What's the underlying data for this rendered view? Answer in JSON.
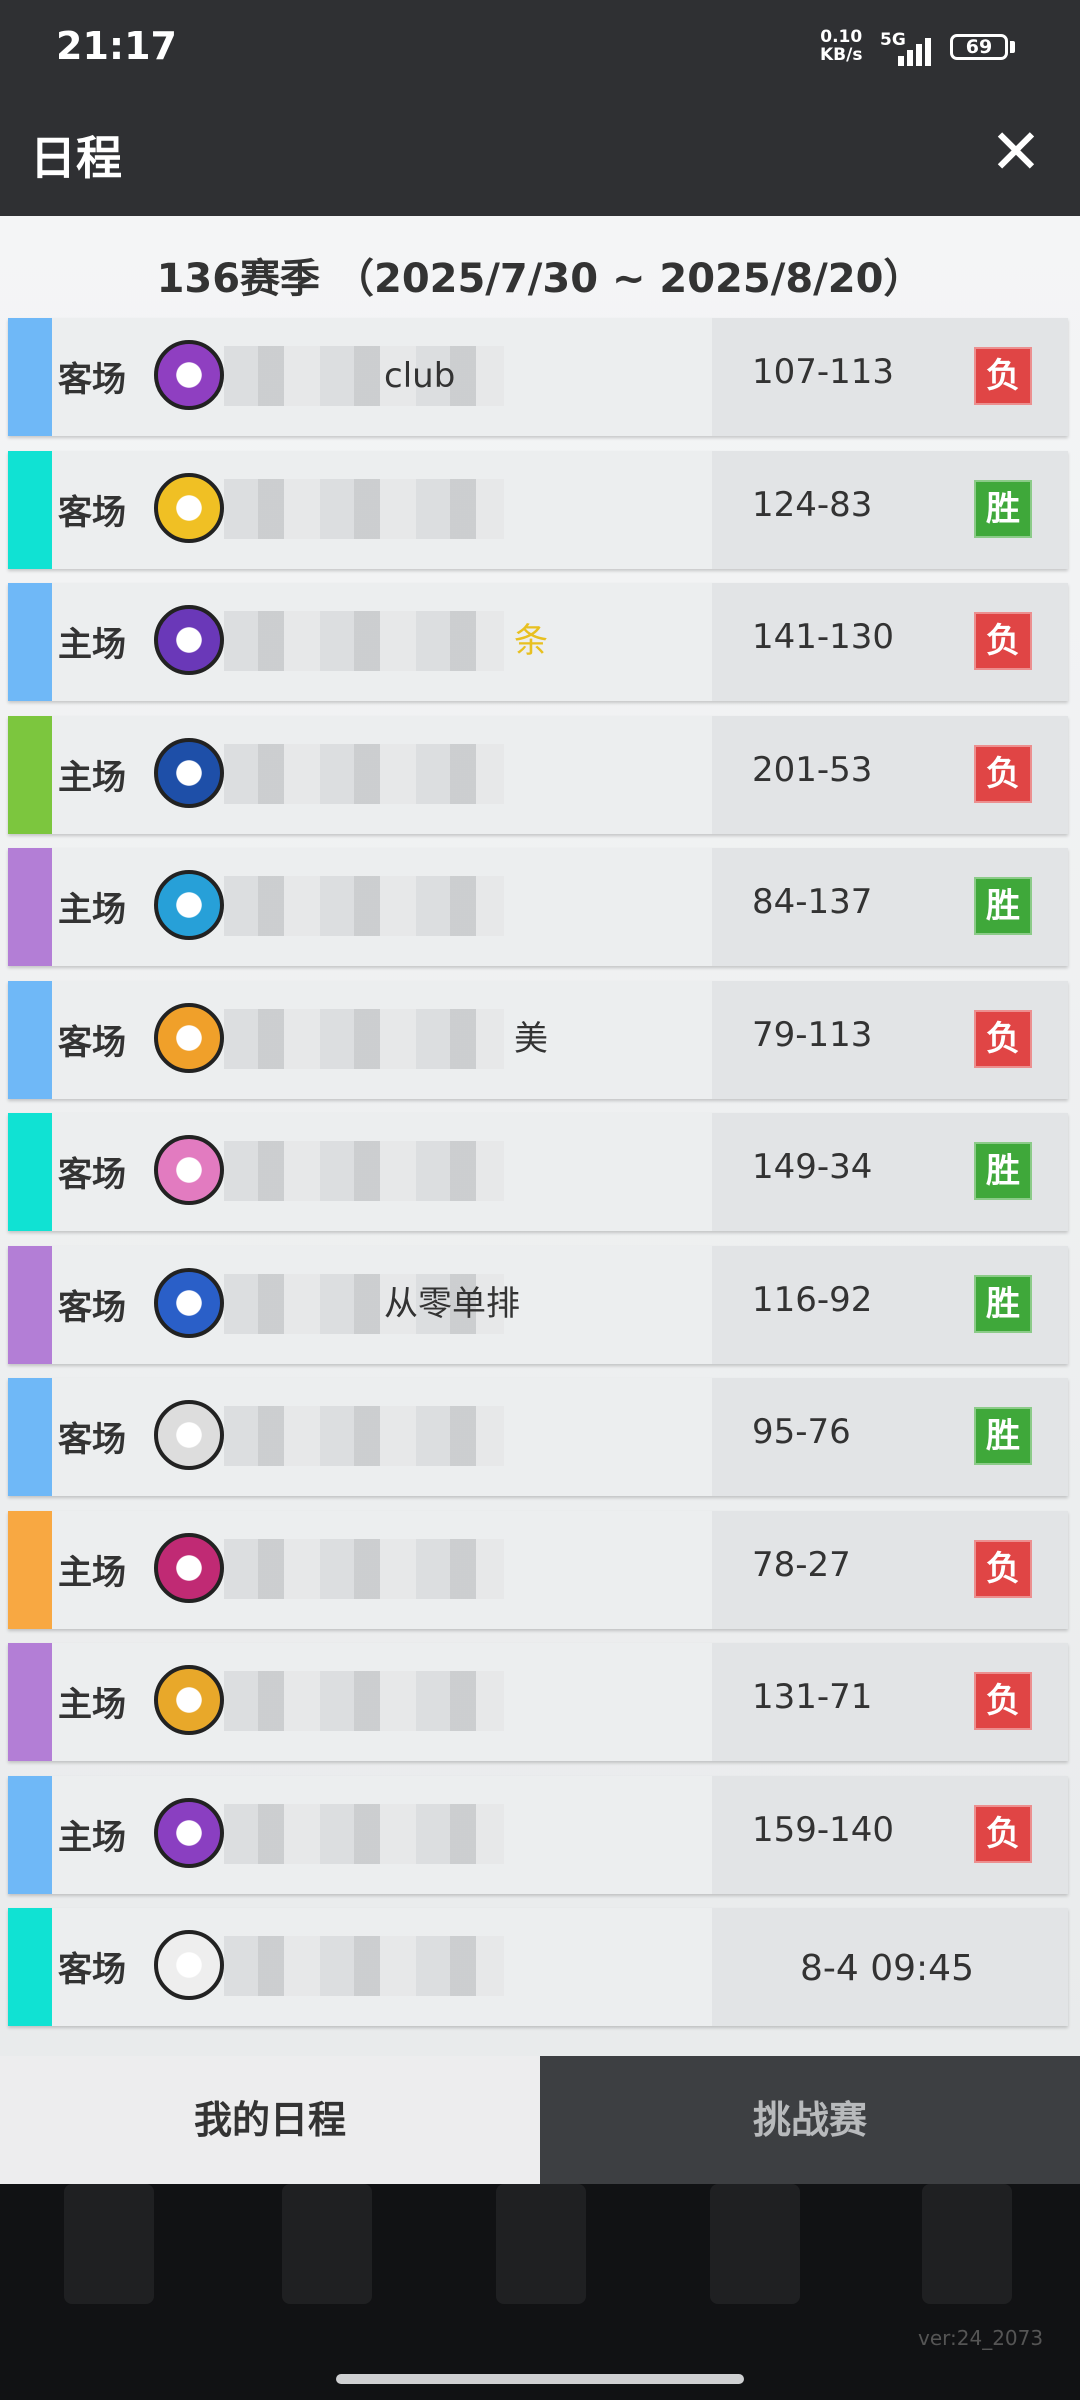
{
  "status_bar": {
    "time": "21:17",
    "net_speed": "0.10",
    "net_unit": "KB/s",
    "network": "5G",
    "battery": "69"
  },
  "header": {
    "title": "日程",
    "close_label": "✕"
  },
  "season": {
    "title": "136赛季 （2025/7/30 ~ 2025/8/20）"
  },
  "matches": [
    {
      "venue": "客场",
      "team_visible": "club",
      "score": "107-113",
      "result": "负",
      "stripe": "#6fb8f7",
      "logo_color": "#8f3fc1"
    },
    {
      "venue": "客场",
      "team_visible": "",
      "score": "124-83",
      "result": "胜",
      "stripe": "#10e2d3",
      "logo_color": "#f0c024"
    },
    {
      "venue": "主场",
      "team_visible": "条",
      "score": "141-130",
      "result": "负",
      "stripe": "#6fb8f7",
      "logo_color": "#6a38b8"
    },
    {
      "venue": "主场",
      "team_visible": "",
      "score": "201-53",
      "result": "负",
      "stripe": "#7cc63e",
      "logo_color": "#1e4fa8"
    },
    {
      "venue": "主场",
      "team_visible": "",
      "score": "84-137",
      "result": "胜",
      "stripe": "#b37ed6",
      "logo_color": "#27a0d8"
    },
    {
      "venue": "客场",
      "team_visible": "美",
      "score": "79-113",
      "result": "负",
      "stripe": "#6fb8f7",
      "logo_color": "#f0a02a"
    },
    {
      "venue": "客场",
      "team_visible": "",
      "score": "149-34",
      "result": "胜",
      "stripe": "#10e2d3",
      "logo_color": "#e27bc0"
    },
    {
      "venue": "客场",
      "team_visible": "从零单排",
      "score": "116-92",
      "result": "胜",
      "stripe": "#b37ed6",
      "logo_color": "#2a5fc8"
    },
    {
      "venue": "客场",
      "team_visible": "",
      "score": "95-76",
      "result": "胜",
      "stripe": "#6fb8f7",
      "logo_color": "#dddddd"
    },
    {
      "venue": "主场",
      "team_visible": "",
      "score": "78-27",
      "result": "负",
      "stripe": "#f8a842",
      "logo_color": "#c02a74"
    },
    {
      "venue": "主场",
      "team_visible": "",
      "score": "131-71",
      "result": "负",
      "stripe": "#b37ed6",
      "logo_color": "#e8a82a"
    },
    {
      "venue": "主场",
      "team_visible": "",
      "score": "159-140",
      "result": "负",
      "stripe": "#6fb8f7",
      "logo_color": "#8a3fc1"
    },
    {
      "venue": "客场",
      "team_visible": "",
      "schedule": "8-4 09:45",
      "stripe": "#10e2d3",
      "logo_color": "#eeeeee"
    }
  ],
  "tabs": {
    "my_schedule": "我的日程",
    "challenge": "挑战赛"
  },
  "version": "ver:24_2073"
}
